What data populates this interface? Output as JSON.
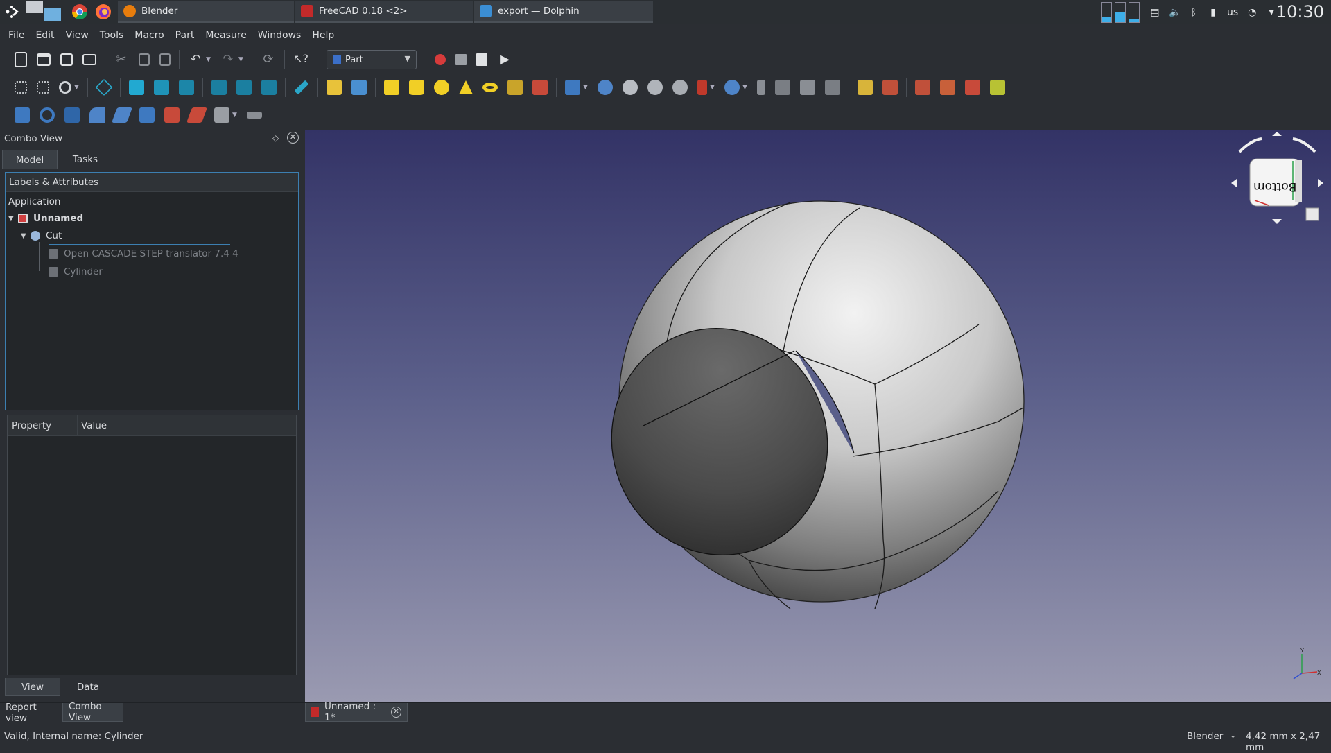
{
  "taskbar": {
    "tasks": [
      {
        "label": "Blender"
      },
      {
        "label": "FreeCAD 0.18 <2>"
      },
      {
        "label": "export — Dolphin"
      }
    ],
    "keyboard_layout": "us",
    "clock": "10:30"
  },
  "menubar": {
    "items": [
      "File",
      "Edit",
      "View",
      "Tools",
      "Macro",
      "Part",
      "Measure",
      "Windows",
      "Help"
    ]
  },
  "toolbar": {
    "workbench": "Part"
  },
  "combo_view": {
    "title": "Combo View",
    "tabs": [
      "Model",
      "Tasks"
    ],
    "tree_header": "Labels & Attributes",
    "tree": {
      "root": "Application",
      "document": "Unnamed",
      "cut": "Cut",
      "child1": "Open CASCADE STEP translator 7.4 4",
      "child2": "Cylinder"
    },
    "property_columns": [
      "Property",
      "Value"
    ],
    "bottom_tabs": [
      "View",
      "Data"
    ]
  },
  "navcube": {
    "face_label": "Bottom"
  },
  "doc_tab": {
    "label": "Unnamed : 1*"
  },
  "panel_tabs": [
    "Report view",
    "Combo View"
  ],
  "status": {
    "message": "Valid, Internal name: Cylinder",
    "nav_style": "Blender",
    "dimensions": "4,42 mm x 2,47 mm"
  },
  "colors": {
    "accent": "#3c7fb1",
    "viewport_top": "#333366",
    "viewport_bottom": "#9a9ab1",
    "record": "#d63b3b"
  }
}
